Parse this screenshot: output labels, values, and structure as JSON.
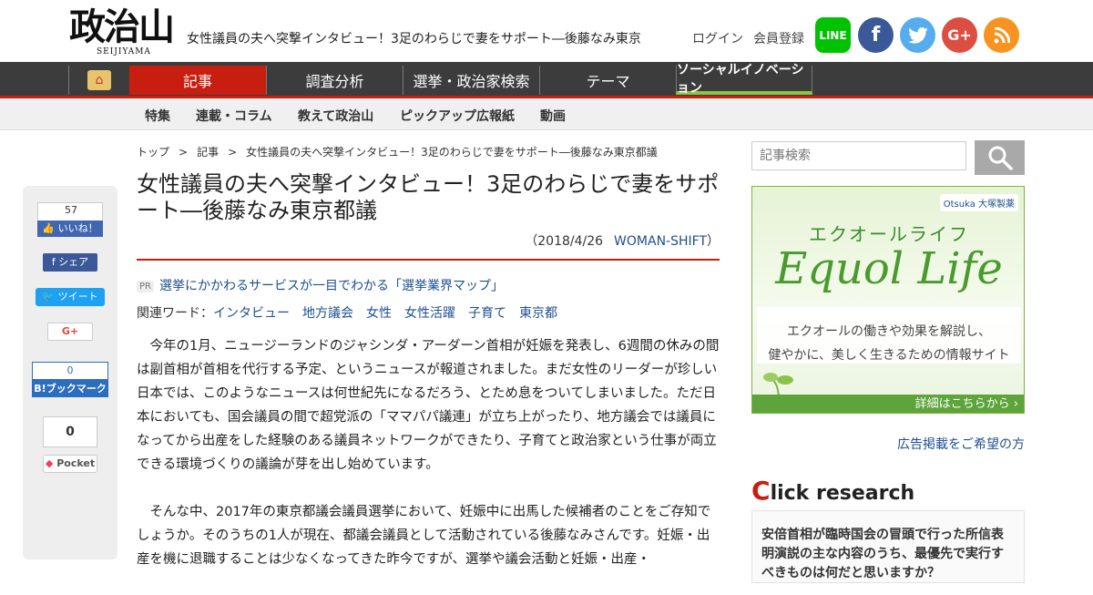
{
  "header": {
    "logo_main": "政治山",
    "logo_sub": "SEIJIYAMA",
    "page_heading": "女性議員の夫へ突撃インタビュー！3足のわらじで妻をサポート―後藤なみ東京",
    "login": "ログイン",
    "register": "会員登録",
    "sns": {
      "line": "LINE",
      "facebook": "f",
      "twitter": "🐦",
      "googleplus": "G+",
      "rss": "RSS"
    }
  },
  "nav": {
    "home": "⌂",
    "items": [
      "記事",
      "調査分析",
      "選挙・政治家検索",
      "テーマ",
      "ソーシャルイノベーション"
    ]
  },
  "subnav": {
    "items": [
      "特集",
      "連載・コラム",
      "教えて政治山",
      "ピックアップ広報紙",
      "動画"
    ]
  },
  "breadcrumb": [
    "トップ",
    "記事",
    "女性議員の夫へ突撃インタビュー！3足のわらじで妻をサポート―後藤なみ東京都議"
  ],
  "breadcrumb_sep": ">",
  "article": {
    "title": "女性議員の夫へ突撃インタビュー！3足のわらじで妻をサポート―後藤なみ東京都議",
    "date": "（2018/4/26",
    "source": "WOMAN-SHIFT",
    "close_paren": "）",
    "pr_badge": "PR",
    "pr_text": "選挙にかかわるサービスが一目でわかる「選挙業界マップ」",
    "keywords_label": "関連ワード：",
    "keywords": [
      "インタビュー",
      "地方議会",
      "女性",
      "女性活躍",
      "子育て",
      "東京都"
    ],
    "paragraphs": [
      "今年の1月、ニュージーランドのジャシンダ・アーダーン首相が妊娠を発表し、6週間の休みの間は副首相が首相を代行する予定、というニュースが報道されました。まだ女性のリーダーが珍しい日本では、このようなニュースは何世紀先になるだろう、とため息をついてしまいました。ただ日本においても、国会議員の間で超党派の「ママパパ議連」が立ち上がったり、地方議会では議員になってから出産をした経験のある議員ネットワークができたり、子育てと政治家という仕事が両立できる環境づくりの議論が芽を出し始めています。",
      "そんな中、2017年の東京都議会議員選挙において、妊娠中に出馬した候補者のことをご存知でしょうか。そのうちの1人が現在、都議会議員として活動されている後藤なみさんです。妊娠・出産を機に退職することは少なくなってきた昨今ですが、選挙や議会活動と妊娠・出産・"
    ]
  },
  "share": {
    "like_count": "57",
    "like_label": "👍 いいね！",
    "fb_share": "f シェア",
    "tweet": "🐦 ツイート",
    "gplus": "G+",
    "hatena_count": "0",
    "hatena_label": "B!ブックマーク",
    "pocket_count": "0",
    "pocket_label": "Pocket"
  },
  "sidebar": {
    "search_placeholder": "記事検索",
    "ad": {
      "brand": "Otsuka 大塚製薬",
      "title_jp": "エクオールライフ",
      "title_en": "Equol Life",
      "desc_line1": "エクオールの働きや効果を解説し、",
      "desc_line2": "健やかに、美しく生きるための情報サイト",
      "cta": "詳細はこちらから ›"
    },
    "ad_link": "広告掲載をご希望の方",
    "click_research": {
      "title_first": "C",
      "title_rest": "lick research",
      "question": "安倍首相が臨時国会の冒頭で行った所信表明演説の主な内容のうち、最優先で実行すべきものは何だと思いますか？"
    }
  },
  "colors": {
    "accent": "#c81e0f",
    "nav_bg": "#3c3c3c",
    "link": "#1d4f91",
    "social_green": "#8cc63f"
  }
}
